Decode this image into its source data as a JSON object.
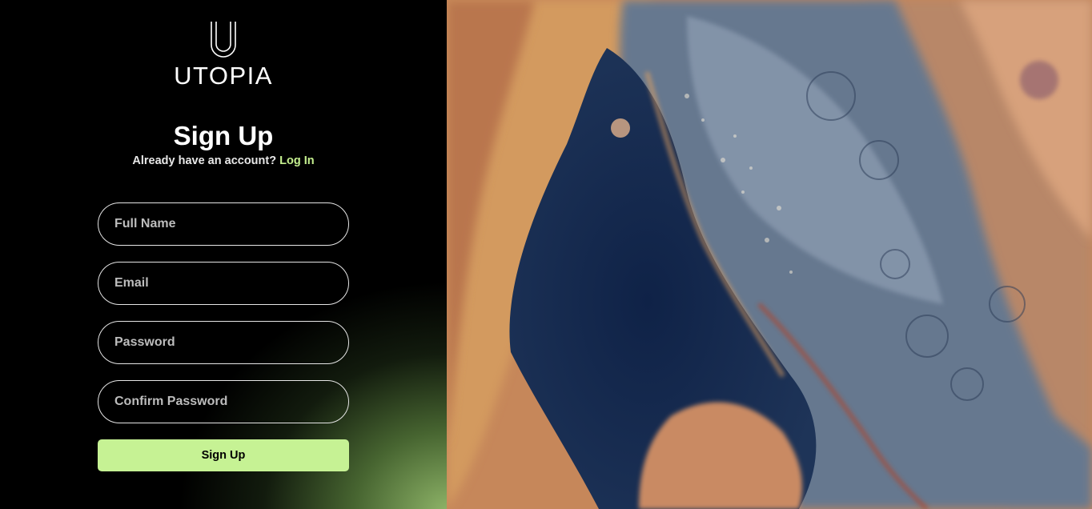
{
  "brand": {
    "name": "UTOPIA",
    "mark": "U"
  },
  "signup": {
    "title": "Sign Up",
    "prompt": "Already have an account?",
    "login_link": "Log In",
    "fields": {
      "full_name_placeholder": "Full Name",
      "email_placeholder": "Email",
      "password_placeholder": "Password",
      "confirm_password_placeholder": "Confirm Password"
    },
    "submit_label": "Sign Up"
  },
  "colors": {
    "accent": "#c6f294",
    "link": "#c5f08f",
    "background": "#000000"
  }
}
